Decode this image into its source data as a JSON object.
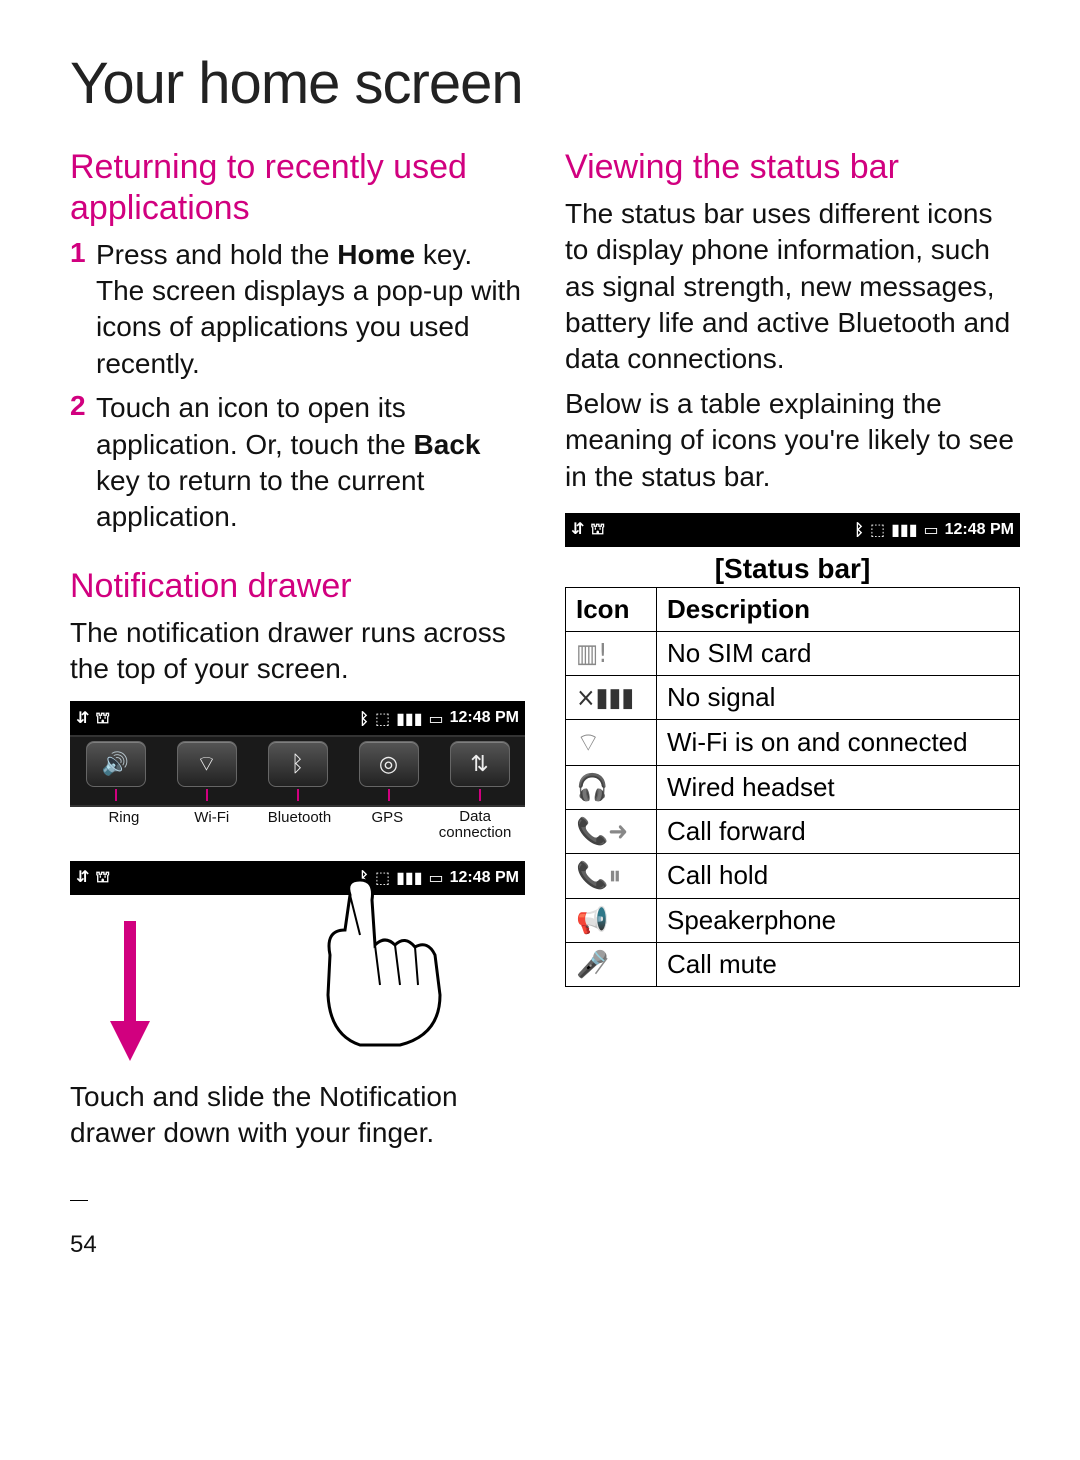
{
  "page_title": "Your home screen",
  "page_number": "54",
  "left": {
    "returning_heading": "Returning to recently used applications",
    "steps": {
      "s1": {
        "num": "1",
        "pre": "Press and hold the ",
        "bold": "Home",
        "post": " key. The screen displays a pop-up with icons of applications you used recently."
      },
      "s2": {
        "num": "2",
        "pre": "Touch an icon to open its application. Or, touch the ",
        "bold": "Back",
        "post": " key to return to the current application."
      }
    },
    "notif_heading": "Notification drawer",
    "notif_body": "The notification drawer runs across the top of your screen.",
    "statusbar_time": "12:48 PM",
    "toggles": {
      "ring_label": "Ring",
      "wifi_label": "Wi-Fi",
      "bt_label": "Bluetooth",
      "gps_label": "GPS",
      "data_label": "Data connection"
    },
    "slide_caption": "Touch and slide the Notification drawer down with your finger."
  },
  "right": {
    "viewing_heading": "Viewing the status bar",
    "viewing_body1": "The status bar uses different icons to display phone information, such as signal strength, new messages, battery life and active Bluetooth and data connections.",
    "viewing_body2": "Below is a table explaining the meaning of icons you're likely to see in the status bar.",
    "statusbar_time": "12:48 PM",
    "statusbar_caption": "[Status bar]",
    "table": {
      "h_icon": "Icon",
      "h_desc": "Description",
      "r1_desc": "No SIM card",
      "r2_desc": "No signal",
      "r3_desc": "Wi-Fi is on and connected",
      "r4_desc": "Wired headset",
      "r5_desc": "Call forward",
      "r6_desc": "Call hold",
      "r7_desc": "Speakerphone",
      "r8_desc": "Call mute"
    }
  }
}
